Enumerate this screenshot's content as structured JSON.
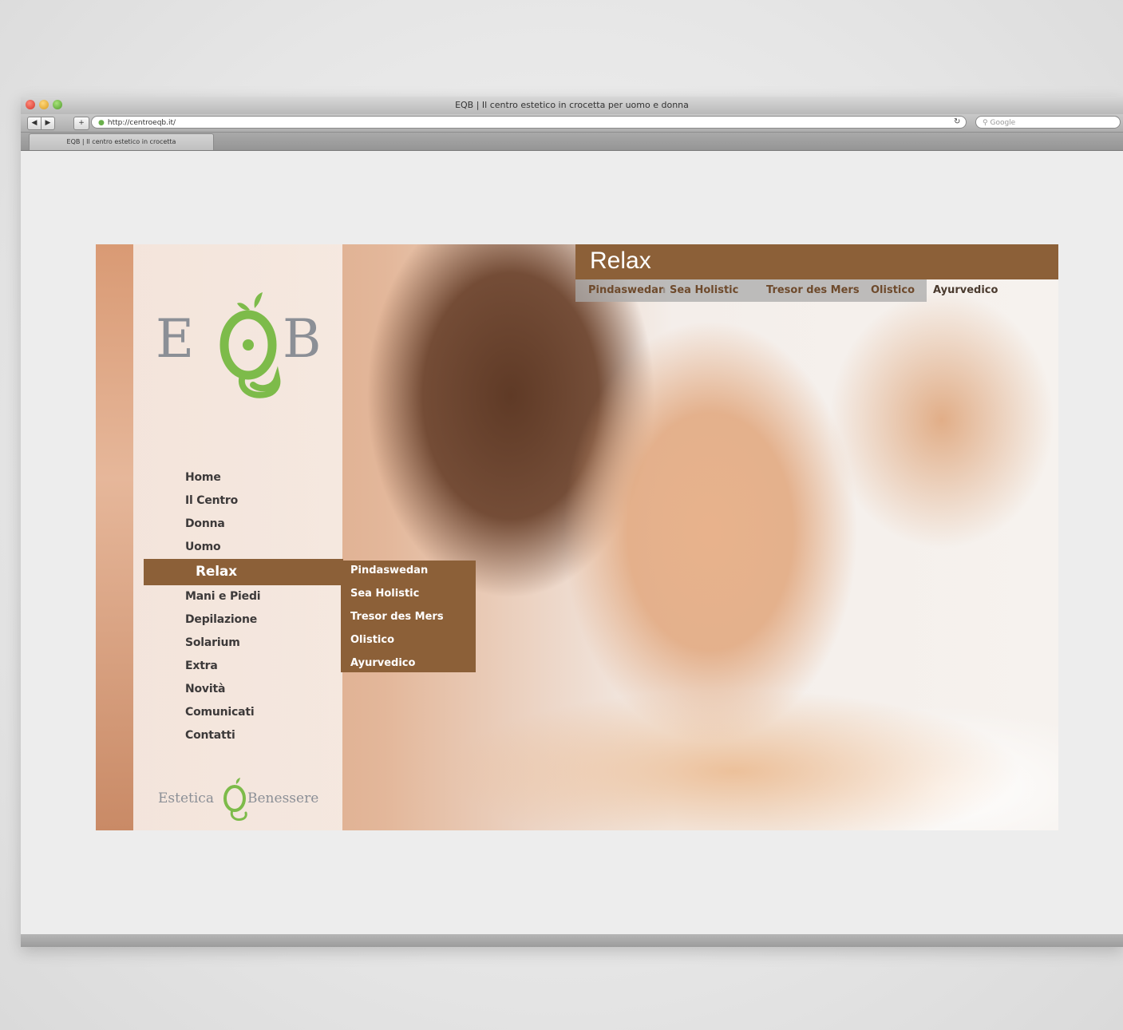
{
  "browser": {
    "window_title": "EQB | Il centro estetico in crocetta per uomo e donna",
    "address": "http://centroeqb.it/",
    "search_placeholder": "Google",
    "tab_label": "EQB | Il centro estetico in crocetta"
  },
  "site": {
    "logo": {
      "left_letter": "E",
      "right_letter": "B"
    },
    "menu": [
      {
        "label": "Home"
      },
      {
        "label": "Il Centro"
      },
      {
        "label": "Donna"
      },
      {
        "label": "Uomo"
      },
      {
        "label": "Relax",
        "active": true
      },
      {
        "label": "Mani e Piedi"
      },
      {
        "label": "Depilazione"
      },
      {
        "label": "Solarium"
      },
      {
        "label": "Extra"
      },
      {
        "label": "Novità"
      },
      {
        "label": "Comunicati"
      },
      {
        "label": "Contatti"
      }
    ],
    "submenu": [
      {
        "label": "Pindaswedan"
      },
      {
        "label": "Sea Holistic"
      },
      {
        "label": "Tresor des Mers"
      },
      {
        "label": "Olistico"
      },
      {
        "label": "Ayurvedico"
      }
    ],
    "section_title": "Relax",
    "section_tabs": [
      {
        "label": "Pindaswedan"
      },
      {
        "label": "Sea Holistic"
      },
      {
        "label": "Tresor des Mers"
      },
      {
        "label": "Olistico"
      },
      {
        "label": "Ayurvedico"
      }
    ],
    "footer_logo": {
      "left": "Estetica",
      "right": "Benessere"
    }
  },
  "colors": {
    "brand_brown": "#8c6038",
    "logo_green": "#7dbb4a",
    "logo_gray": "#8b8f96"
  }
}
